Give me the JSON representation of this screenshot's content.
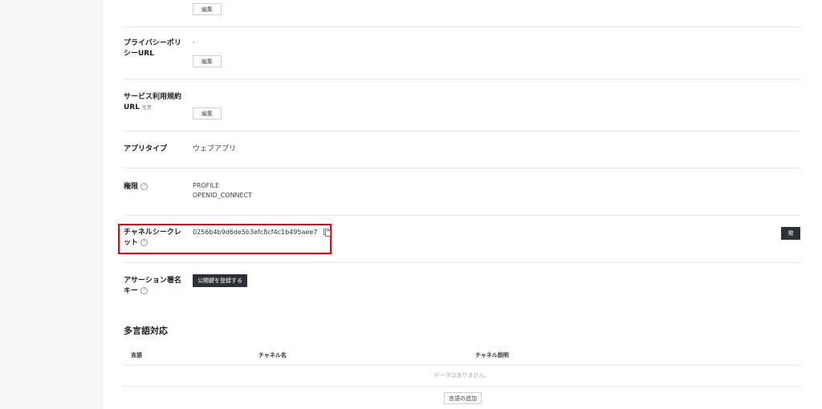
{
  "top": {
    "edit_label": "編集"
  },
  "privacy_policy": {
    "label": "プライバシーポリシーURL",
    "value": "-",
    "edit_label": "編集"
  },
  "terms_of_service": {
    "label": "サービス利用規約URL",
    "optional_tag": "任意",
    "edit_label": "編集"
  },
  "app_type": {
    "label": "アプリタイプ",
    "value": "ウェブアプリ"
  },
  "permissions": {
    "label": "権限",
    "values": [
      "PROFILE",
      "OPENID_CONNECT"
    ]
  },
  "channel_secret": {
    "label": "チャネルシークレット",
    "value": "0256b4b9d6de5b3efc8cf4c1b495aee7",
    "issue_label": "発行"
  },
  "assertion_key": {
    "label": "アサーション署名キー",
    "register_label": "公開鍵を登録する"
  },
  "multilingual": {
    "title": "多言語対応",
    "columns": [
      "言語",
      "チャネル名",
      "チャネル説明"
    ],
    "empty_text": "データはありません。",
    "add_label": "言語の追加"
  },
  "colors": {
    "highlight": "#e60012",
    "dark_button": "#2d3135"
  }
}
